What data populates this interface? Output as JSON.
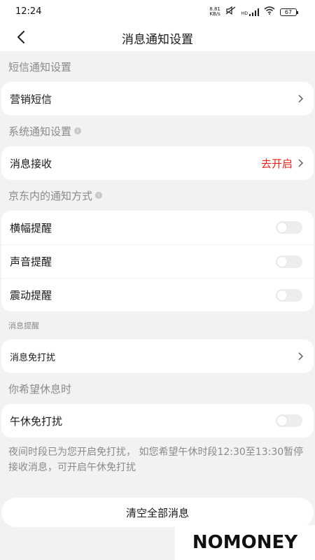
{
  "status_bar": {
    "time": "12:24",
    "net_speed_value": "8.81",
    "net_speed_unit": "KB/s",
    "signal_label": "HD",
    "battery": "67"
  },
  "header": {
    "title": "消息通知设置",
    "back_icon": "chevron-left-icon"
  },
  "sections": {
    "sms": {
      "title": "短信通知设置",
      "items": [
        {
          "label": "营销短信"
        }
      ]
    },
    "system": {
      "title": "系统通知设置",
      "items": [
        {
          "label": "消息接收",
          "action": "去开启"
        }
      ]
    },
    "in_app": {
      "title": "京东内的通知方式",
      "items": [
        {
          "label": "横幅提醒",
          "enabled": false
        },
        {
          "label": "声音提醒",
          "enabled": false
        },
        {
          "label": "震动提醒",
          "enabled": false
        }
      ]
    },
    "reminder": {
      "title": "消息提醒",
      "items": [
        {
          "label": "消息免打扰"
        }
      ]
    },
    "rest": {
      "title": "你希望休息时",
      "items": [
        {
          "label": "午休免打扰",
          "enabled": false
        }
      ],
      "note": "夜间时段已为您开启免打扰， 如您希望午休时段12:30至13:30暂停接收消息，可开启午休免打扰"
    }
  },
  "clear_button": "清空全部消息",
  "watermark": "NOMONEY",
  "colors": {
    "accent": "#e2231a",
    "background": "#f2f2f2",
    "card": "#ffffff",
    "muted_text": "#8a8a8a"
  }
}
